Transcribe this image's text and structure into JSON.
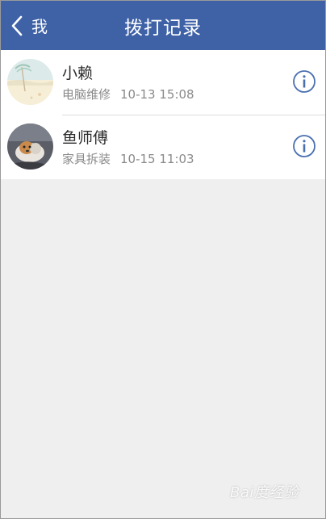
{
  "header": {
    "back_label": "我",
    "title": "拨打记录"
  },
  "calls": [
    {
      "name": "小赖",
      "service": "电脑维修",
      "time": "10-13 15:08"
    },
    {
      "name": "鱼师傅",
      "service": "家具拆装",
      "time": "10-15 11:03"
    }
  ],
  "colors": {
    "header_bg": "#3f62a7",
    "info_icon": "#4a6fb0",
    "page_bg": "#efefef"
  },
  "watermark": "Bai度经验"
}
